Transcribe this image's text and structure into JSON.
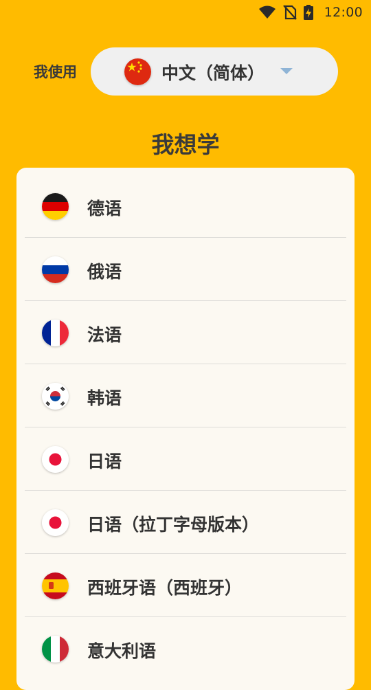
{
  "status_bar": {
    "time": "12:00",
    "icons": [
      "wifi-icon",
      "no-sim-icon",
      "battery-charging-icon"
    ]
  },
  "language_selector": {
    "label": "我使用",
    "selected": "中文（简体）",
    "selected_flag": "china-flag-icon"
  },
  "heading": "我想学",
  "languages": [
    {
      "label": "德语",
      "flag": "germany-flag-icon"
    },
    {
      "label": "俄语",
      "flag": "russia-flag-icon"
    },
    {
      "label": "法语",
      "flag": "france-flag-icon"
    },
    {
      "label": "韩语",
      "flag": "south-korea-flag-icon"
    },
    {
      "label": "日语",
      "flag": "japan-flag-icon"
    },
    {
      "label": "日语（拉丁字母版本）",
      "flag": "japan-flag-icon"
    },
    {
      "label": "西班牙语（西班牙）",
      "flag": "spain-flag-icon"
    },
    {
      "label": "意大利语",
      "flag": "italy-flag-icon"
    }
  ],
  "colors": {
    "background": "#FFBB00",
    "card": "#FCF9F2",
    "selector": "#F0F0F0",
    "caret": "#8FB4D6"
  }
}
